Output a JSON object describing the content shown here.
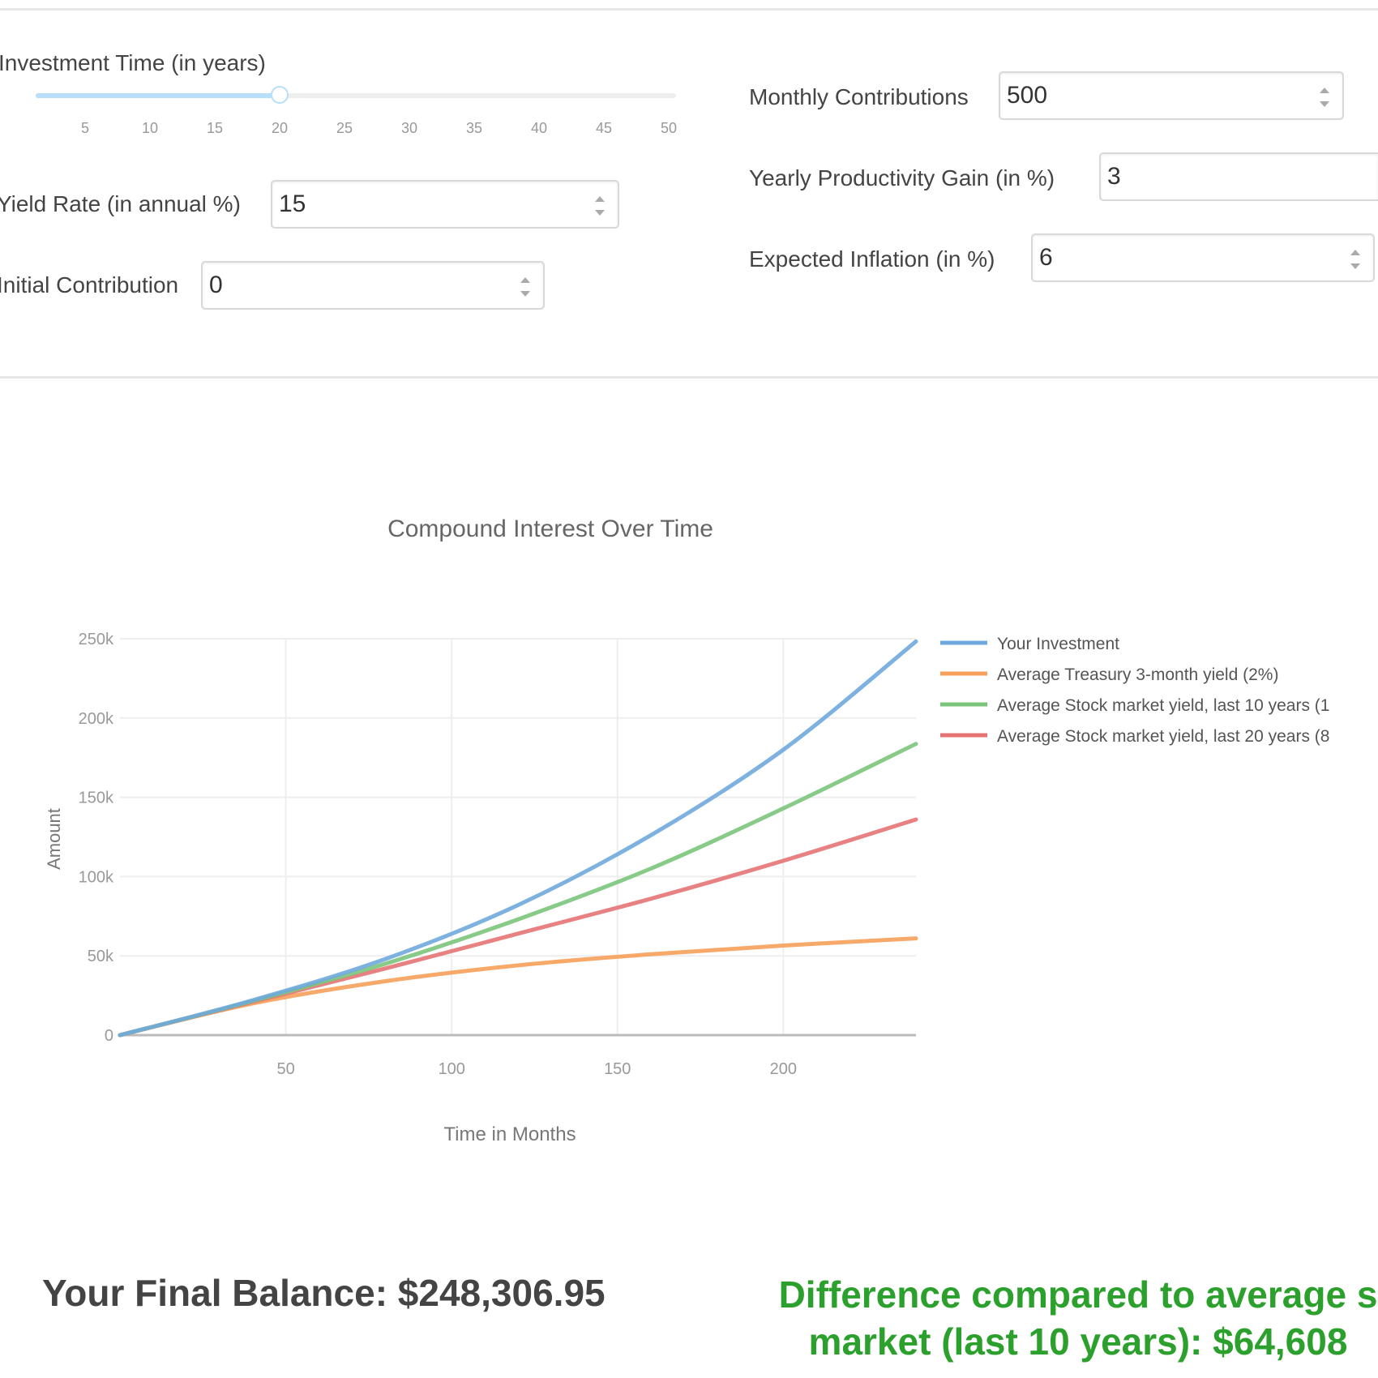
{
  "controls": {
    "investment_time": {
      "label": "Investment Time (in years)",
      "value": 20,
      "min": 1,
      "max": 50,
      "ticks": [
        "5",
        "10",
        "15",
        "20",
        "25",
        "30",
        "35",
        "40",
        "45",
        "50"
      ]
    },
    "yield_rate": {
      "label": "Yield Rate (in annual %)",
      "value": "15"
    },
    "initial_contribution": {
      "label": "Initial Contribution",
      "value": "0"
    },
    "monthly_contributions": {
      "label": "Monthly Contributions",
      "value": "500"
    },
    "productivity_gain": {
      "label": "Yearly Productivity Gain (in %)",
      "value": "3"
    },
    "expected_inflation": {
      "label": "Expected Inflation (in %)",
      "value": "6"
    }
  },
  "chart_data": {
    "type": "line",
    "title": "Compound Interest Over Time",
    "xlabel": "Time in Months",
    "ylabel": "Amount",
    "xlim": [
      0,
      240
    ],
    "ylim": [
      0,
      250000
    ],
    "xticks": [
      "50",
      "100",
      "150",
      "200"
    ],
    "yticks": [
      "0",
      "50k",
      "100k",
      "150k",
      "200k",
      "250k"
    ],
    "grid": true,
    "legend_position": "top-right",
    "x": [
      0,
      40,
      80,
      120,
      160,
      200,
      240
    ],
    "series": [
      {
        "name": "Your Investment",
        "color": "#6fa8dc",
        "values": [
          0,
          22000,
          48000,
          82000,
          126000,
          180000,
          248306.95
        ]
      },
      {
        "name": "Average Treasury 3-month yield (2%)",
        "color": "#f6a05a",
        "values": [
          0,
          20000,
          34000,
          44000,
          51000,
          56500,
          61000
        ]
      },
      {
        "name": "Average Stock market yield, last 10 years (1",
        "color": "#7bc57b",
        "values": [
          0,
          21500,
          45000,
          73000,
          105000,
          143000,
          183698
        ]
      },
      {
        "name": "Average Stock market yield, last 20 years (8",
        "color": "#e57373",
        "values": [
          0,
          21000,
          42000,
          64000,
          86000,
          110000,
          136000
        ]
      }
    ]
  },
  "results": {
    "final_balance": "Your Final Balance: $248,306.95",
    "difference_line1": "Difference compared to average s",
    "difference_line2": "market (last 10 years): $64,608"
  }
}
